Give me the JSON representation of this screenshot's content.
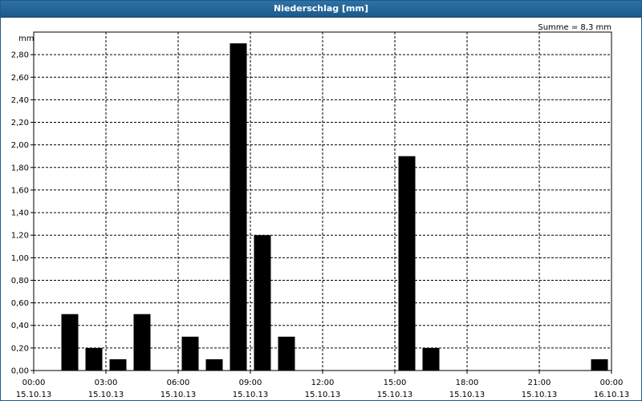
{
  "window": {
    "title": "Niederschlag [mm]"
  },
  "chart_data": {
    "type": "bar",
    "title": "Niederschlag [mm]",
    "summary": "Summe = 8,3 mm",
    "ylabel": "mm",
    "ylim": [
      0,
      3.0
    ],
    "y_ticks": [
      "0,00",
      "0,20",
      "0,40",
      "0,60",
      "0,80",
      "1,00",
      "1,20",
      "1,40",
      "1,60",
      "1,80",
      "2,00",
      "2,20",
      "2,40",
      "2,60",
      "2,80"
    ],
    "x_unit": "hour",
    "x_range": [
      0,
      24
    ],
    "x_ticks": [
      {
        "time": "00:00",
        "date": "15.10.13"
      },
      {
        "time": "03:00",
        "date": "15.10.13"
      },
      {
        "time": "06:00",
        "date": "15.10.13"
      },
      {
        "time": "09:00",
        "date": "15.10.13"
      },
      {
        "time": "12:00",
        "date": "15.10.13"
      },
      {
        "time": "15:00",
        "date": "15.10.13"
      },
      {
        "time": "18:00",
        "date": "15.10.13"
      },
      {
        "time": "21:00",
        "date": "15.10.13"
      },
      {
        "time": "00:00",
        "date": "16.10.13"
      }
    ],
    "grid": true,
    "x": [
      1,
      2,
      3,
      4,
      5,
      6,
      7,
      8,
      9,
      10,
      11,
      12,
      13,
      14,
      15,
      16,
      17,
      18,
      19,
      20,
      21,
      22,
      23,
      24
    ],
    "values": [
      0,
      0.5,
      0.2,
      0.1,
      0.5,
      0,
      0.3,
      0.1,
      2.9,
      1.2,
      0.3,
      0,
      0,
      0,
      0,
      1.9,
      0.2,
      0,
      0,
      0,
      0,
      0,
      0,
      0.1
    ],
    "colors": {
      "bar": "#000000",
      "grid": "#000000",
      "frame": "#000000"
    }
  }
}
